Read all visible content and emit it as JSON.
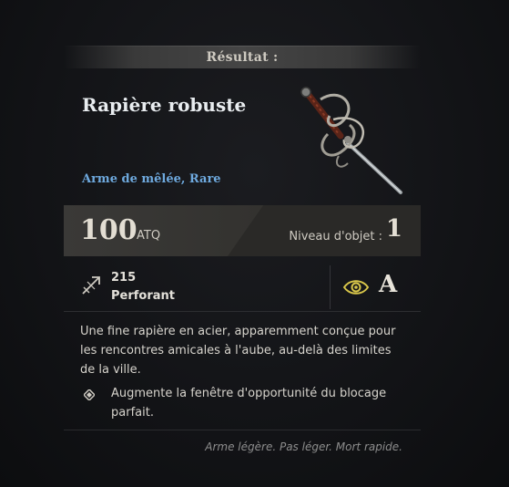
{
  "header": {
    "title": "Résultat :"
  },
  "item": {
    "name": "Rapière robuste",
    "type": "Arme de mêlée, Rare",
    "image": "rapier-sword-image"
  },
  "stats": {
    "attack_value": "100",
    "attack_unit": "ATQ",
    "item_level_label": "Niveau d'objet :",
    "item_level_value": "1",
    "damage_value": "215",
    "damage_type": "Perforant",
    "damage_icon": "piercing-arrow-icon",
    "scaling_icon": "eye-icon",
    "scaling_grade": "A"
  },
  "description": "Une fine rapière en acier, apparemment conçue pour les rencontres amicales à l'aube, au-delà des limites de la ville.",
  "perks": [
    {
      "icon": "diamond-bullet-icon",
      "text": "Augmente la fenêtre d'opportunité du blocage parfait."
    }
  ],
  "flavor_text": "Arme légère. Pas léger. Mort rapide.",
  "colors": {
    "item_type": "#6ea9de",
    "scaling_icon": "#d8c64a",
    "flavor_text": "#8d8d8d"
  }
}
